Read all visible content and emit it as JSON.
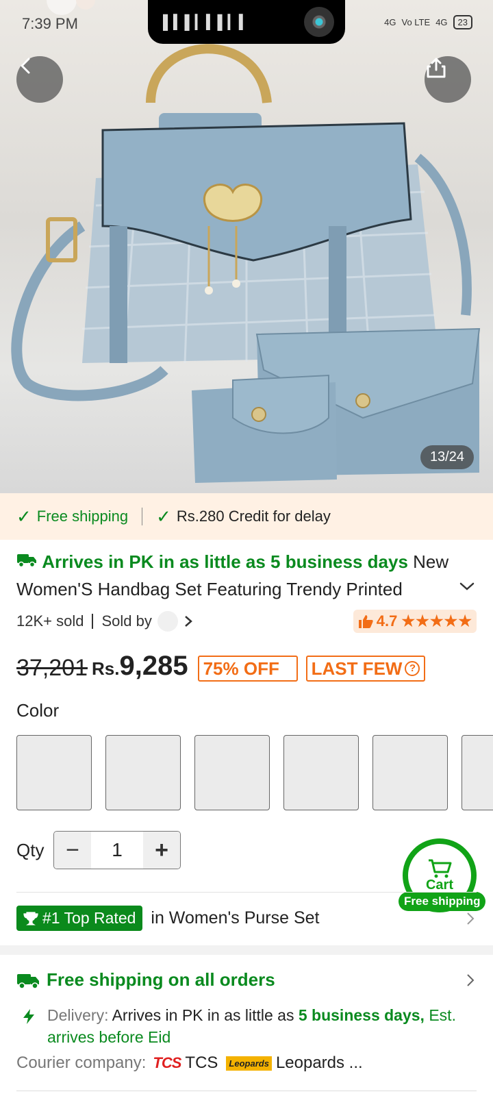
{
  "status_bar": {
    "time": "7:39 PM",
    "network1": "4G",
    "network2": "Vo LTE",
    "network3": "4G",
    "battery": "23"
  },
  "gallery": {
    "counter": "13/24"
  },
  "shipping_banner": {
    "free_shipping": "Free shipping",
    "credit": "Rs.280 Credit for delay"
  },
  "product": {
    "arrives": "Arrives in PK in as little as 5 business days",
    "title_tail": "New",
    "title_line2": "Women'S Handbag Set Featuring Trendy Printed",
    "sold": "12K+ sold",
    "sold_by": "Sold by",
    "rating": "4.7",
    "stars": "★★★★★",
    "original_price": "37,201",
    "currency": "Rs.",
    "price": "9,285",
    "discount": "75% OFF",
    "stock_badge": "LAST FEW",
    "stock_help": "?"
  },
  "color": {
    "label": "Color"
  },
  "quantity": {
    "label": "Qty",
    "value": "1",
    "minus": "−",
    "plus": "+"
  },
  "cart": {
    "label": "Cart",
    "badge": "Free shipping"
  },
  "top_rated": {
    "badge": "#1 Top Rated",
    "category": "in Women's Purse Set"
  },
  "shipping_info": {
    "title": "Free shipping on all orders",
    "delivery_label": "Delivery:",
    "delivery_text": "Arrives in PK in as little as",
    "delivery_days": "5 business days,",
    "delivery_est": "Est. arrives before Eid",
    "courier_label": "Courier company:",
    "courier_tcs_logo": "TCS",
    "courier_tcs": "TCS",
    "courier_leopards_logo": "Leopards",
    "courier_leopards": "Leopards ..."
  },
  "colors": {
    "accent_green": "#0a8a1f",
    "accent_orange": "#f26d16",
    "bag_blue": "#8fadc2"
  }
}
